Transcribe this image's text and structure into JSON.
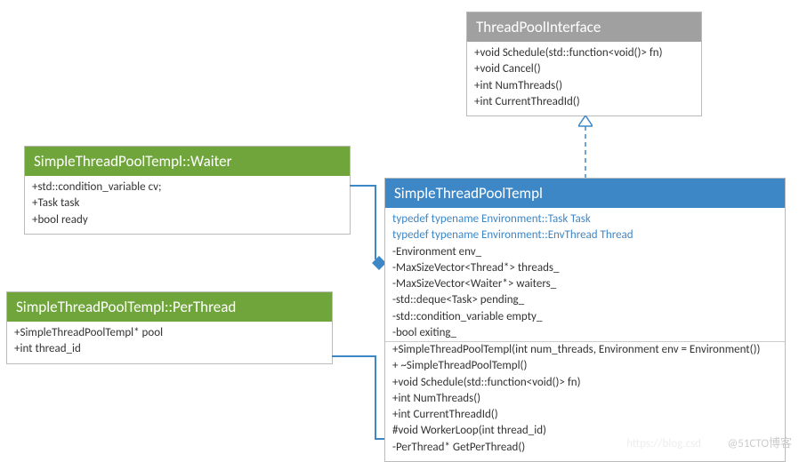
{
  "interface": {
    "name": "ThreadPoolInterface",
    "m": [
      "+void Schedule(std::function<void()> fn)",
      "+void Cancel()",
      "+int NumThreads()",
      "+int CurrentThreadId()"
    ]
  },
  "waiter": {
    "name": "SimpleThreadPoolTempl::Waiter",
    "m": [
      "+std::condition_variable cv;",
      "+Task task",
      "+bool ready"
    ]
  },
  "perthread": {
    "name": "SimpleThreadPoolTempl::PerThread",
    "m": [
      "+SimpleThreadPoolTempl* pool",
      "+int thread_id"
    ]
  },
  "main": {
    "name": "SimpleThreadPoolTempl",
    "typedefs": [
      "typedef typename Environment::Task Task",
      "typedef typename Environment::EnvThread Thread"
    ],
    "fields": [
      "-Environment env_",
      "-MaxSizeVector<Thread*> threads_",
      "-MaxSizeVector<Waiter*> waiters_",
      "-std::deque<Task> pending_",
      "-std::condition_variable empty_",
      "-bool exiting_"
    ],
    "methods": [
      "+SimpleThreadPoolTempl(int num_threads, Environment env = Environment())",
      "+ ~SimpleThreadPoolTempl()",
      "+void Schedule(std::function<void()> fn)",
      "+int NumThreads()",
      "+int CurrentThreadId()",
      "#void WorkerLoop(int thread_id)",
      "-PerThread* GetPerThread()"
    ]
  },
  "watermark": "@51CTO博客",
  "watermark2": "https://blog.csd"
}
